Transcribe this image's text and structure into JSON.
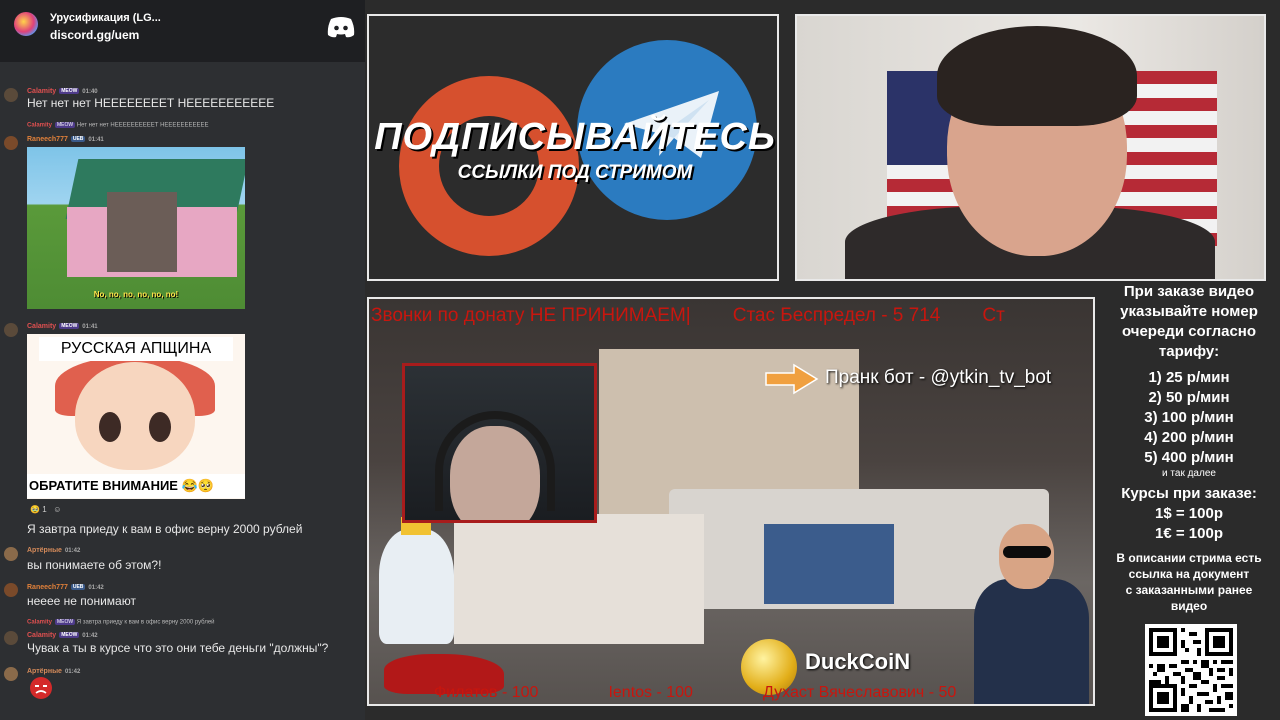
{
  "chat": {
    "server_name": "Урусификация (LG...",
    "server_invite": "discord.gg/uem",
    "messages": [
      {
        "author": "Calamity",
        "badge": "MEOW",
        "time": "01:40",
        "text": "Нет нет нет НЕЕЕЕЕЕЕЕТ НЕЕЕЕЕЕЕЕЕЕЕ"
      },
      {
        "reply_author": "Calamity",
        "reply_badge": "MEOW",
        "reply_text": "Нет нет нет НЕЕЕЕЕЕЕЕЕЕТ НЕЕЕЕЕЕЕЕЕЕЕ"
      },
      {
        "author": "Raneech777",
        "badge": "UEB",
        "time": "01:41",
        "image_caption": "No, no, no, no, no, no!"
      },
      {
        "author": "Calamity",
        "badge": "MEOW",
        "time": "01:41",
        "image_top": "РУССКАЯ АПЩИНА",
        "image_bottom": "ОБРАТИТЕ ВНИМАНИЕ 😂🥺"
      },
      {
        "reaction_count": "1",
        "text": "Я завтра приеду к вам в офис верну 2000 рублей"
      },
      {
        "author": "Артёрные",
        "time": "01:42",
        "text": "вы понимаете об этом?!"
      },
      {
        "author": "Raneech777",
        "badge": "UEB",
        "time": "01:42",
        "text": "нееее не понимают"
      },
      {
        "reply_author": "Calamity",
        "reply_badge": "MEOW",
        "reply_text": "Я завтра приеду к вам в офис верну 2000 рублей"
      },
      {
        "author": "Calamity",
        "badge": "MEOW",
        "time": "01:42",
        "text": "Чувак а ты в курсе что это они тебе деньги \"должны\"?"
      },
      {
        "author": "Артёрные",
        "time": "01:42"
      }
    ]
  },
  "promo": {
    "title": "ПОДПИСЫВАЙТЕСЬ",
    "subtitle": "ССЫЛКИ ПОД СТРИМОМ"
  },
  "stream": {
    "ticker_top": [
      "Звонки по донату НЕ ПРИНИМАЕМ|",
      "Стас Беспредел - 5 714",
      "Ст"
    ],
    "ticker_bottom": [
      "Филатов - 100",
      "Ientos - 100",
      "Духаст Вячеславович - 50"
    ],
    "prank_bot": "Пранк бот - @ytkin_tv_bot",
    "coin_label": "DuckCoiN"
  },
  "info": {
    "intro": [
      "При заказе видео",
      "указывайте номер",
      "очереди согласно",
      "тарифу:"
    ],
    "tariffs": [
      "1) 25 р/мин",
      "2) 50 р/мин",
      "3) 100 р/мин",
      "4) 200 р/мин",
      "5) 400 р/мин"
    ],
    "etc": "и так далее",
    "rates_title": "Курсы при заказе:",
    "rates": [
      "1$ = 100р",
      "1€ = 100р"
    ],
    "desc": [
      "В описании стрима есть",
      "ссылка на документ",
      "с заказанными ранее",
      "видео"
    ]
  },
  "colors": {
    "ticker_red": "#c8160e",
    "patreon_orange": "#d6502e",
    "telegram_blue": "#2b7bc0",
    "frame_white": "#e9e9e9"
  }
}
